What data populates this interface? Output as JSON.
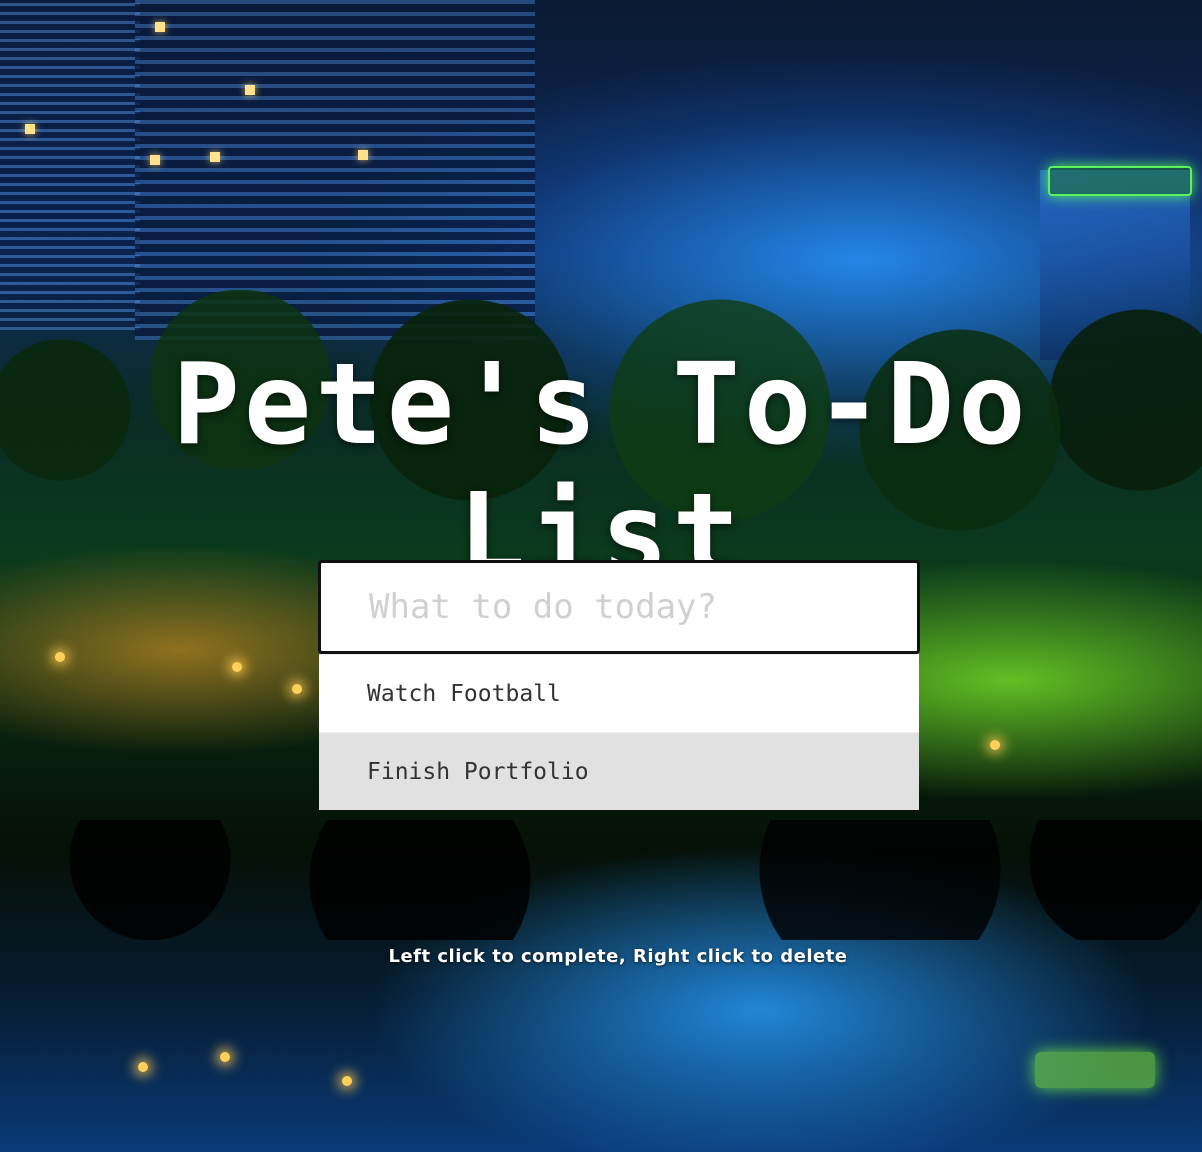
{
  "title": "Pete's To-Do List",
  "input": {
    "placeholder": "What to do today?",
    "value": ""
  },
  "todos": [
    {
      "text": "Watch Football"
    },
    {
      "text": "Finish Portfolio"
    }
  ],
  "hint": "Left click to complete, Right click to delete",
  "background": {
    "icon": "night-city-lake-photo"
  }
}
